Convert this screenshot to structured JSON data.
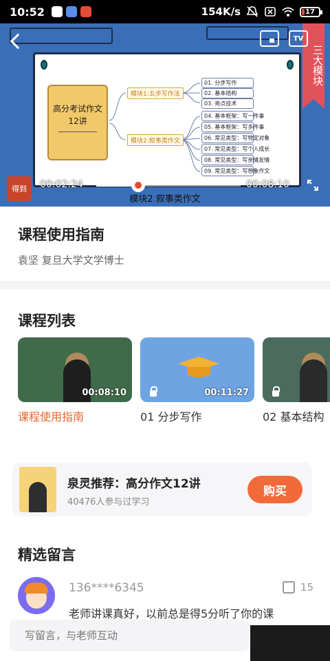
{
  "status": {
    "time": "10:52",
    "speed": "154K/s",
    "battery": "17",
    "battery_level": 0.17
  },
  "video": {
    "ribbon": "三大模块",
    "logo": "得到",
    "tv": "TV",
    "current_time": "00:02:24",
    "total_time": "00:08:10",
    "progress": 0.29,
    "subtitle": "模块2 叙事类作文",
    "board": {
      "book_title_1": "高分考试作文",
      "book_title_2": "12讲",
      "module1": "模块1:五步写作法",
      "module2": "模块2:叙事类作文",
      "items": [
        "01. 分步写作",
        "02. 基本结构",
        "03. 亮点技术",
        "04. 基本框架：写一件事",
        "05. 基本框架：写多件事",
        "06. 常见类型：写特定对象",
        "07. 常见类型：写个人成长",
        "08. 常见类型：写亲情友情",
        "09. 常见类型：写想象作文"
      ]
    }
  },
  "course": {
    "title": "课程使用指南",
    "author": "袁坚 复旦大学文学博士"
  },
  "list": {
    "heading": "课程列表",
    "items": [
      {
        "label": "课程使用指南",
        "duration": "00:08:10"
      },
      {
        "label": "01 分步写作",
        "duration": "00:11:27"
      },
      {
        "label": "02 基本结构",
        "duration": ""
      }
    ]
  },
  "promo": {
    "name": "泉灵推荐：高分作文12讲",
    "count": "40476人参与过学习",
    "buy": "购买",
    "cover_text": "泉灵推荐 高分作文12讲"
  },
  "comments": {
    "heading": "精选留言",
    "first": {
      "user": "136****6345",
      "likes": "15",
      "text": "老师讲课真好，以前总是得5分听了你的课"
    }
  },
  "input": {
    "placeholder": "写留言，与老师互动"
  },
  "colors": {
    "accent": "#f26a3a",
    "video_bg": "#3a6fb8",
    "ribbon": "#e0535a"
  }
}
